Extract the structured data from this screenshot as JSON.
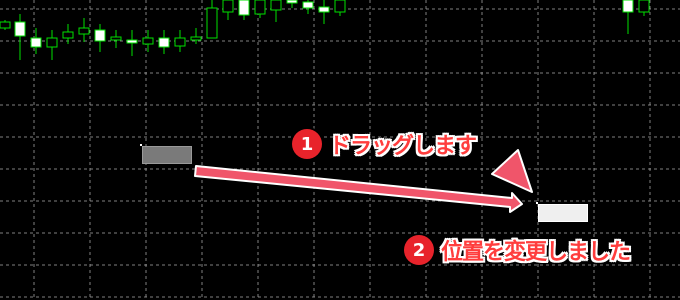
{
  "chart": {
    "background": "#000000",
    "grid_color": "#aaaaaa",
    "up_color": "#ffffff",
    "wick_color": "#00e000",
    "body_border": "#00e000"
  },
  "annotation_color": "#f0556a",
  "steps": [
    {
      "number": "1",
      "text": "ドラッグします"
    },
    {
      "number": "2",
      "text": "位置を変更しました"
    }
  ]
}
